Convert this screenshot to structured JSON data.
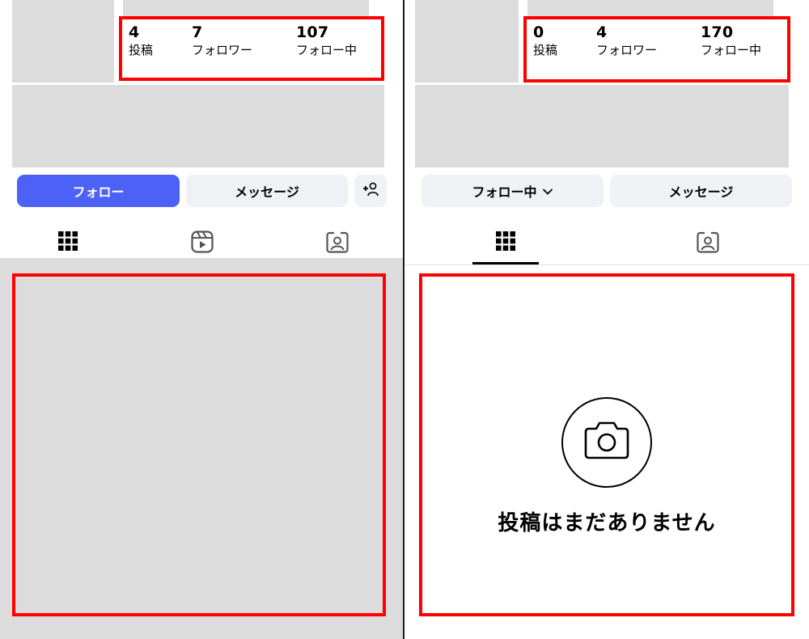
{
  "left": {
    "stats": [
      {
        "value": "4",
        "label": "投稿"
      },
      {
        "value": "7",
        "label": "フォロワー"
      },
      {
        "value": "107",
        "label": "フォロー中"
      }
    ],
    "buttons": {
      "follow": "フォロー",
      "message": "メッセージ",
      "add_person_icon": "add-person-icon"
    },
    "tabs": [
      "grid-icon",
      "reels-icon",
      "tagged-icon"
    ],
    "content": "placeholder-grid"
  },
  "right": {
    "stats": [
      {
        "value": "0",
        "label": "投稿"
      },
      {
        "value": "4",
        "label": "フォロワー"
      },
      {
        "value": "170",
        "label": "フォロー中"
      }
    ],
    "buttons": {
      "following": "フォロー中",
      "message": "メッセージ"
    },
    "tabs": [
      "grid-icon",
      "tagged-icon"
    ],
    "empty_state": {
      "icon": "camera-icon",
      "text": "投稿はまだありません"
    }
  },
  "colors": {
    "accent": "#4c62f6",
    "highlight": "#ff0000",
    "placeholder": "#dcdcdc",
    "button_gray": "#eff1f5"
  }
}
